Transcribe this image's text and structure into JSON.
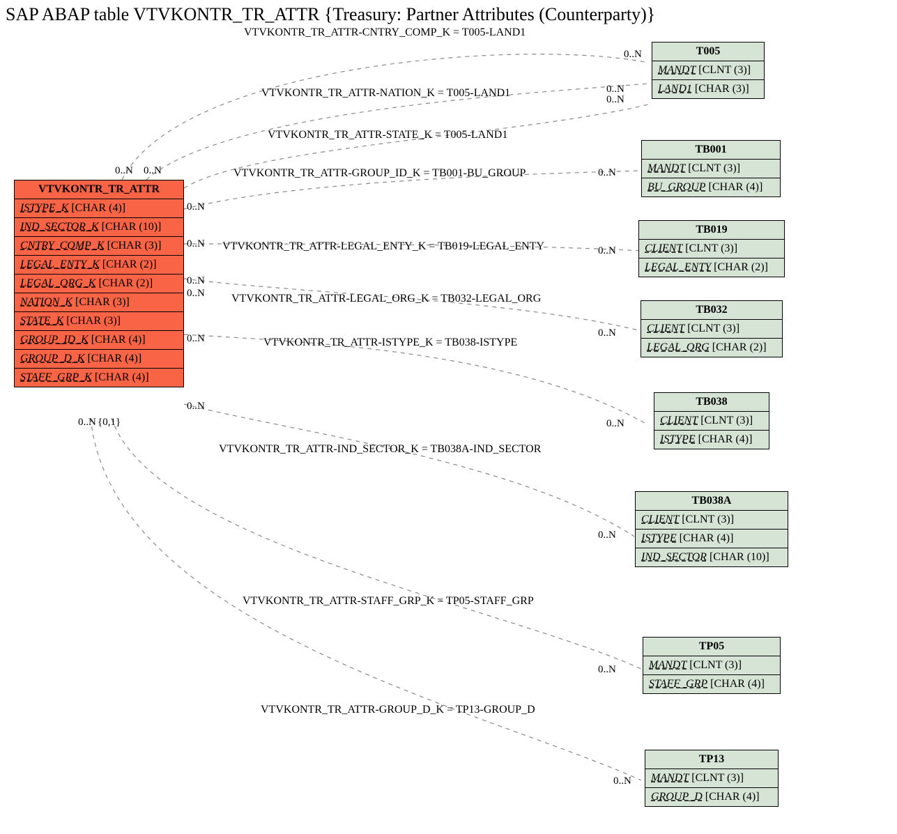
{
  "title": "SAP ABAP table VTVKONTR_TR_ATTR {Treasury: Partner Attributes (Counterparty)}",
  "main_entity": {
    "name": "VTVKONTR_TR_ATTR",
    "fields": [
      {
        "name": "ISTYPE_K",
        "type": "[CHAR (4)]"
      },
      {
        "name": "IND_SECTOR_K",
        "type": "[CHAR (10)]"
      },
      {
        "name": "CNTRY_COMP_K",
        "type": "[CHAR (3)]"
      },
      {
        "name": "LEGAL_ENTY_K",
        "type": "[CHAR (2)]"
      },
      {
        "name": "LEGAL_ORG_K",
        "type": "[CHAR (2)]"
      },
      {
        "name": "NATION_K",
        "type": "[CHAR (3)]"
      },
      {
        "name": "STATE_K",
        "type": "[CHAR (3)]"
      },
      {
        "name": "GROUP_ID_K",
        "type": "[CHAR (4)]"
      },
      {
        "name": "GROUP_D_K",
        "type": "[CHAR (4)]"
      },
      {
        "name": "STAFF_GRP_K",
        "type": "[CHAR (4)]"
      }
    ]
  },
  "ref_entities": [
    {
      "name": "T005",
      "fields": [
        {
          "name": "MANDT",
          "type": "[CLNT (3)]"
        },
        {
          "name": "LAND1",
          "type": "[CHAR (3)]"
        }
      ]
    },
    {
      "name": "TB001",
      "fields": [
        {
          "name": "MANDT",
          "type": "[CLNT (3)]"
        },
        {
          "name": "BU_GROUP",
          "type": "[CHAR (4)]"
        }
      ]
    },
    {
      "name": "TB019",
      "fields": [
        {
          "name": "CLIENT",
          "type": "[CLNT (3)]"
        },
        {
          "name": "LEGAL_ENTY",
          "type": "[CHAR (2)]"
        }
      ]
    },
    {
      "name": "TB032",
      "fields": [
        {
          "name": "CLIENT",
          "type": "[CLNT (3)]"
        },
        {
          "name": "LEGAL_ORG",
          "type": "[CHAR (2)]"
        }
      ]
    },
    {
      "name": "TB038",
      "fields": [
        {
          "name": "CLIENT",
          "type": "[CLNT (3)]"
        },
        {
          "name": "ISTYPE",
          "type": "[CHAR (4)]"
        }
      ]
    },
    {
      "name": "TB038A",
      "fields": [
        {
          "name": "CLIENT",
          "type": "[CLNT (3)]"
        },
        {
          "name": "ISTYPE",
          "type": "[CHAR (4)]"
        },
        {
          "name": "IND_SECTOR",
          "type": "[CHAR (10)]"
        }
      ]
    },
    {
      "name": "TP05",
      "fields": [
        {
          "name": "MANDT",
          "type": "[CLNT (3)]"
        },
        {
          "name": "STAFF_GRP",
          "type": "[CHAR (4)]"
        }
      ]
    },
    {
      "name": "TP13",
      "fields": [
        {
          "name": "MANDT",
          "type": "[CLNT (3)]"
        },
        {
          "name": "GROUP_D",
          "type": "[CHAR (4)]"
        }
      ]
    }
  ],
  "relations": [
    {
      "label": "VTVKONTR_TR_ATTR-CNTRY_COMP_K = T005-LAND1"
    },
    {
      "label": "VTVKONTR_TR_ATTR-NATION_K = T005-LAND1"
    },
    {
      "label": "VTVKONTR_TR_ATTR-STATE_K = T005-LAND1"
    },
    {
      "label": "VTVKONTR_TR_ATTR-GROUP_ID_K = TB001-BU_GROUP"
    },
    {
      "label": "VTVKONTR_TR_ATTR-LEGAL_ENTY_K = TB019-LEGAL_ENTY"
    },
    {
      "label": "VTVKONTR_TR_ATTR-LEGAL_ORG_K = TB032-LEGAL_ORG"
    },
    {
      "label": "VTVKONTR_TR_ATTR-ISTYPE_K = TB038-ISTYPE"
    },
    {
      "label": "VTVKONTR_TR_ATTR-IND_SECTOR_K = TB038A-IND_SECTOR"
    },
    {
      "label": "VTVKONTR_TR_ATTR-STAFF_GRP_K = TP05-STAFF_GRP"
    },
    {
      "label": "VTVKONTR_TR_ATTR-GROUP_D_K = TP13-GROUP_D"
    }
  ],
  "cardinality": {
    "zero_n": "0..N",
    "zero_one": "{0,1}"
  }
}
